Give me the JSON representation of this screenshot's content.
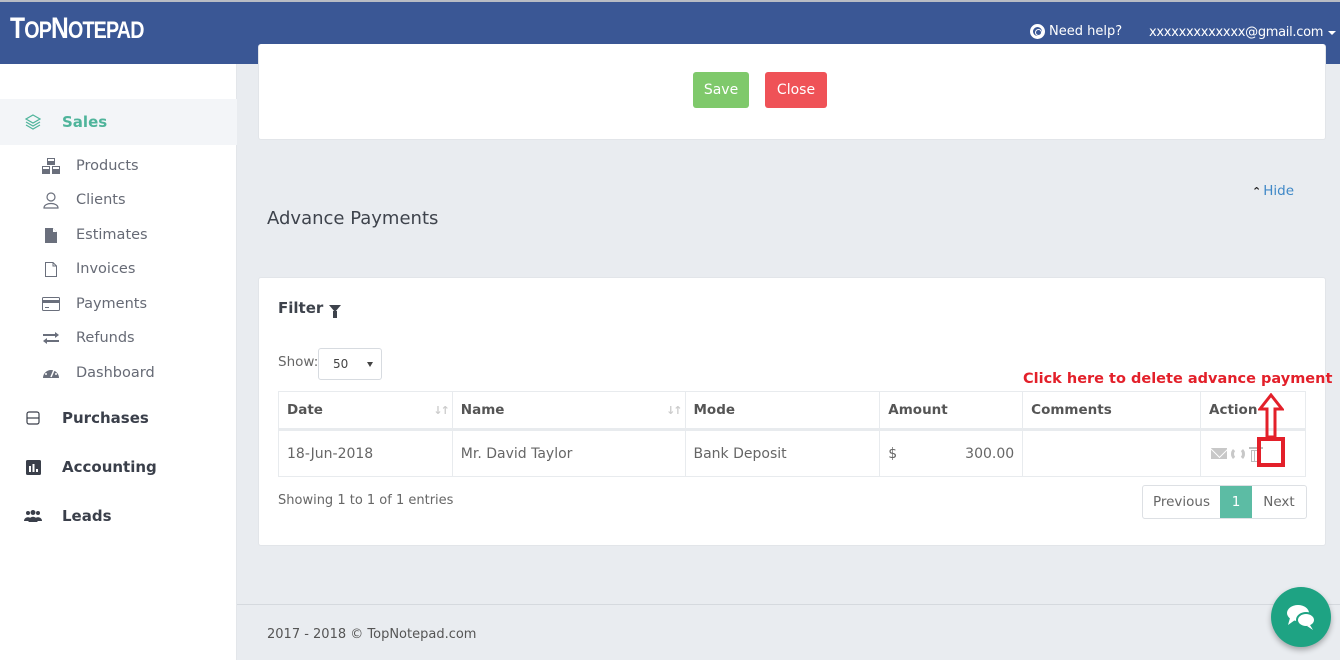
{
  "header": {
    "logo_first": "T",
    "logo_mid": "OP",
    "logo_n": "N",
    "logo_rest": "OTEPAD",
    "help_label": "Need help?",
    "help_icon": "lifebuoy-icon",
    "user_email": "xxxxxxxxxxxxx@gmail.com",
    "user_caret_icon": "caret-down-icon"
  },
  "sidebar": {
    "sales": {
      "label": "Sales",
      "icon": "layers-icon",
      "active": true
    },
    "sub_items": [
      {
        "label": "Products",
        "icon": "cubes-icon"
      },
      {
        "label": "Clients",
        "icon": "user-outline-icon"
      },
      {
        "label": "Estimates",
        "icon": "file-solid-icon"
      },
      {
        "label": "Invoices",
        "icon": "file-outline-icon"
      },
      {
        "label": "Payments",
        "icon": "credit-card-icon"
      },
      {
        "label": "Refunds",
        "icon": "exchange-icon"
      },
      {
        "label": "Dashboard",
        "icon": "tachometer-icon"
      }
    ],
    "purchases": {
      "label": "Purchases",
      "icon": "minus-square-icon"
    },
    "accounting": {
      "label": "Accounting",
      "icon": "bar-chart-icon"
    },
    "leads": {
      "label": "Leads",
      "icon": "users-icon"
    }
  },
  "form_actions": {
    "save_label": "Save",
    "close_label": "Close"
  },
  "hide_label": "Hide",
  "section_title": "Advance Payments",
  "filter": {
    "title": "Filter",
    "show_label": "Show:",
    "show_value": "50"
  },
  "table": {
    "columns": [
      "Date",
      "Name",
      "Mode",
      "Amount",
      "Comments",
      "Action"
    ],
    "rows": [
      {
        "date": "18-Jun-2018",
        "name": "Mr. David Taylor",
        "mode": "Bank Deposit",
        "currency": "$",
        "amount": "300.00",
        "comments": ""
      }
    ],
    "info": "Showing 1 to 1 of 1 entries"
  },
  "pagination": {
    "previous": "Previous",
    "current": "1",
    "next": "Next"
  },
  "annotation": {
    "text": "Click here to delete advance payment",
    "color": "#e3202a"
  },
  "footer": {
    "text": "2017 - 2018 © TopNotepad.com"
  },
  "colors": {
    "header_bg": "#3a5795",
    "accent": "#4fb49b",
    "save": "#7fc96b",
    "close": "#ef5257",
    "chat": "#1ea383"
  }
}
